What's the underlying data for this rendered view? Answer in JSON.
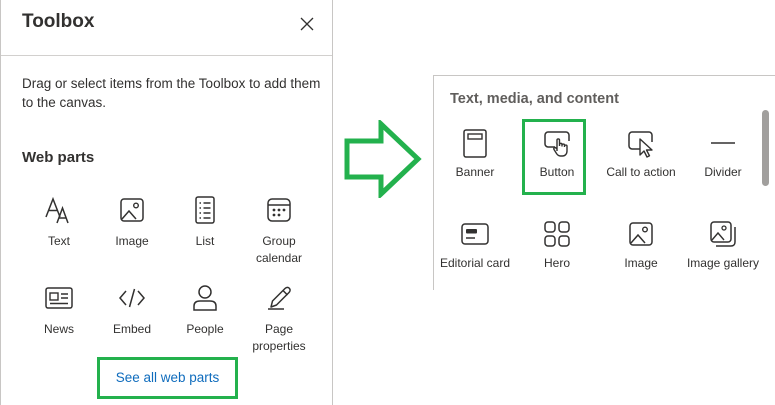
{
  "toolbox": {
    "title": "Toolbox",
    "hint": "Drag or select items from the Toolbox to add them to the canvas.",
    "section_title": "Web parts",
    "items": [
      {
        "label": "Text",
        "icon": "text-icon"
      },
      {
        "label": "Image",
        "icon": "image-icon"
      },
      {
        "label": "List",
        "icon": "list-icon"
      },
      {
        "label": "Group calendar",
        "icon": "calendar-icon"
      },
      {
        "label": "News",
        "icon": "news-icon"
      },
      {
        "label": "Embed",
        "icon": "embed-icon"
      },
      {
        "label": "People",
        "icon": "person-icon"
      },
      {
        "label": "Page properties",
        "icon": "edit-icon"
      }
    ],
    "see_all_label": "See all web parts"
  },
  "panel": {
    "title": "Text, media, and content",
    "items": [
      {
        "label": "Banner",
        "icon": "banner-icon"
      },
      {
        "label": "Button",
        "icon": "button-icon"
      },
      {
        "label": "Call to action",
        "icon": "call-to-action-icon"
      },
      {
        "label": "Divider",
        "icon": "divider-icon"
      },
      {
        "label": "Editorial card",
        "icon": "editorial-card-icon"
      },
      {
        "label": "Hero",
        "icon": "hero-icon"
      },
      {
        "label": "Image",
        "icon": "image-icon"
      },
      {
        "label": "Image gallery",
        "icon": "image-gallery-icon"
      }
    ]
  },
  "colors": {
    "highlight": "#23b14d",
    "link": "#0f6cbd",
    "text": "#323130"
  }
}
